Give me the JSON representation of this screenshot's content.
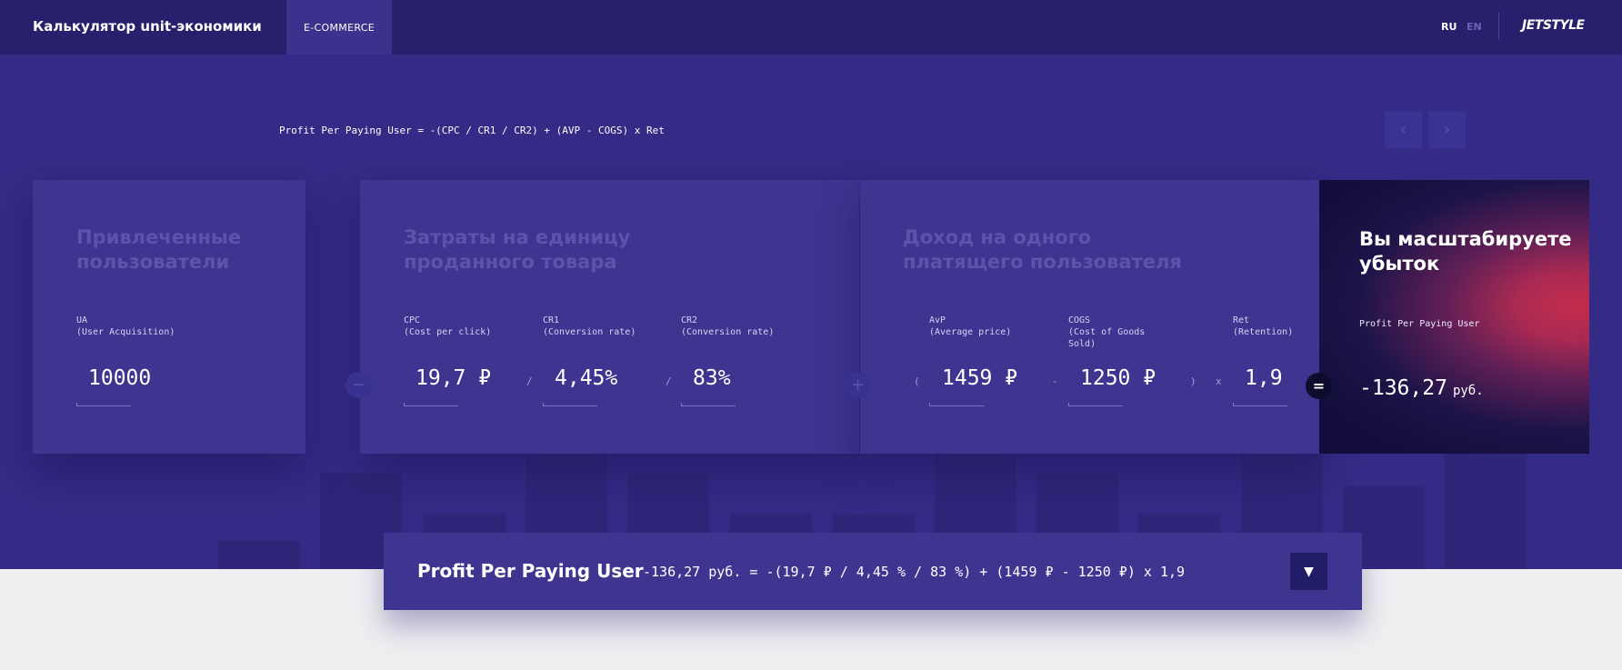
{
  "header": {
    "title": "Калькулятор unit-экономики",
    "tab_ecommerce": "E-COMMERCE",
    "lang_ru": "RU",
    "lang_en": "EN",
    "logo": "JETSTYLE"
  },
  "formula": "Profit Per Paying User = -(CPC / CR1 / CR2) + (AVP - COGS) x Ret",
  "nav": {
    "prev_icon": "chevron-left-icon",
    "next_icon": "chevron-right-icon"
  },
  "ua_card": {
    "heading_line1": "Привлеченные",
    "heading_line2": "пользователи",
    "field_label_line1": "UA",
    "field_label_line2": "(User Acquisition)",
    "value": "10000"
  },
  "cost_card": {
    "heading_line1": "Затраты на единицу",
    "heading_line2": "проданного товара",
    "fields": [
      {
        "label_line1": "CPC",
        "label_line2": "(Cost per click)",
        "value": "19,7 ₽"
      },
      {
        "label_line1": "CR1",
        "label_line2": "(Conversion rate)",
        "value": "4,45%"
      },
      {
        "label_line1": "CR2",
        "label_line2": "(Conversion rate)",
        "value": "83%"
      }
    ],
    "op_divide": "/"
  },
  "income_card": {
    "heading_line1": "Доход на одного",
    "heading_line2": "платящего пользователя",
    "fields": [
      {
        "label_line1": "AvP",
        "label_line2": "(Average price)",
        "label_line3": "",
        "value": "1459 ₽"
      },
      {
        "label_line1": "COGS",
        "label_line2": "(Cost of Goods",
        "label_line3": "Sold)",
        "value": "1250 ₽"
      },
      {
        "label_line1": "Ret",
        "label_line2": "(Retention)",
        "label_line3": "",
        "value": "1,9"
      }
    ],
    "op_open": "(",
    "op_minus": "-",
    "op_close": ")",
    "op_times": "x"
  },
  "operators": {
    "minus": "−",
    "plus": "+",
    "equals": "="
  },
  "result": {
    "title_line1": "Вы масштабируете",
    "title_line2": "убыток",
    "label": "Profit Per Paying User",
    "value": "-136,27",
    "unit": "руб."
  },
  "bottom": {
    "title": "Profit Per Paying User",
    "formula": "-136,27 руб. = -(19,7 ₽ / 4,45 % / 83 %) + (1459 ₽ - 1250 ₽) x 1,9",
    "toggle_icon": "triangle-down-icon"
  },
  "colors": {
    "hero_bg": "#332b85",
    "topbar_bg": "#27206d",
    "card_bg": "#3d3590",
    "result_accent": "#c42c4d",
    "page_bg": "#efeff1"
  }
}
